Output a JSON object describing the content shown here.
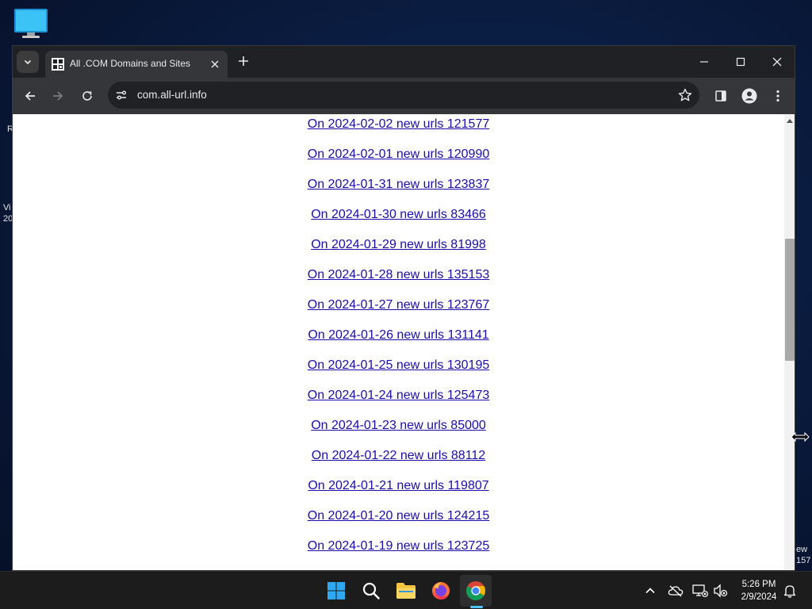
{
  "browser": {
    "tab_title": "All .COM Domains and Sites",
    "url": "com.all-url.info",
    "colors": {
      "frame": "#202124",
      "toolbar": "#35363a",
      "link": "#1a0dab"
    }
  },
  "desktop": {
    "fragments": [
      "R",
      "Vi",
      "20",
      "ew",
      "157"
    ]
  },
  "links": [
    "On 2024-02-02 new urls 121577",
    "On 2024-02-01 new urls 120990",
    "On 2024-01-31 new urls 123837",
    "On 2024-01-30 new urls 83466",
    "On 2024-01-29 new urls 81998",
    "On 2024-01-28 new urls 135153",
    "On 2024-01-27 new urls 123767",
    "On 2024-01-26 new urls 131141",
    "On 2024-01-25 new urls 130195",
    "On 2024-01-24 new urls 125473",
    "On 2024-01-23 new urls 85000",
    "On 2024-01-22 new urls 88112",
    "On 2024-01-21 new urls 119807",
    "On 2024-01-20 new urls 124215",
    "On 2024-01-19 new urls 123725"
  ],
  "scroll": {
    "position_fraction": 0.37
  },
  "taskbar": {
    "apps": [
      "start-icon",
      "search-icon",
      "file-explorer-icon",
      "firefox-icon",
      "chrome-icon"
    ],
    "active_app": "chrome-icon",
    "time": "5:26 PM",
    "date": "2/9/2024"
  }
}
